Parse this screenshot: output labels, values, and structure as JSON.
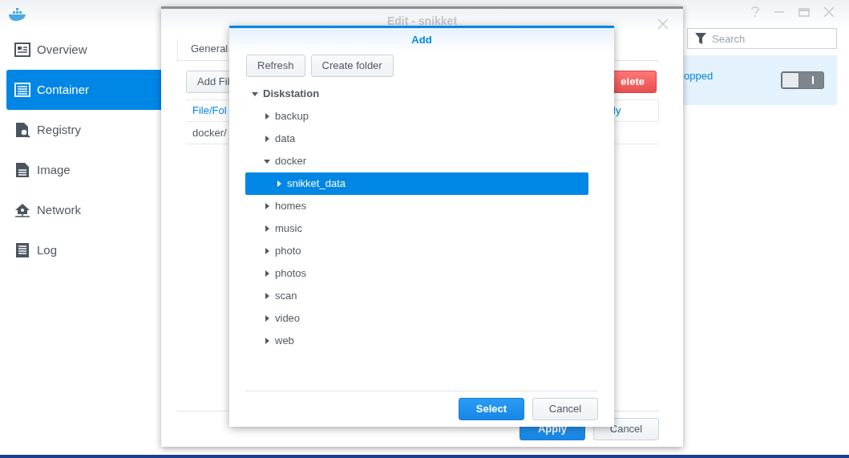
{
  "app": {
    "sidebar": [
      {
        "label": "Overview",
        "selected": false
      },
      {
        "label": "Container",
        "selected": true
      },
      {
        "label": "Registry",
        "selected": false
      },
      {
        "label": "Image",
        "selected": false
      },
      {
        "label": "Network",
        "selected": false
      },
      {
        "label": "Log",
        "selected": false
      }
    ],
    "search": {
      "placeholder": "Search"
    },
    "container_row": {
      "status": "opped",
      "on": false,
      "selected": true
    }
  },
  "edit_window": {
    "title": "Edit - snikket",
    "tab": "General",
    "buttons": [
      {
        "label": "Add Fil",
        "kind": "default"
      },
      {
        "label": "elete",
        "kind": "danger"
      }
    ],
    "columns": [
      "File/Fol",
      "ly"
    ],
    "rows": [
      [
        "docker/"
      ]
    ],
    "footer_buttons": [
      {
        "label": "Apply",
        "kind": "primary"
      },
      {
        "label": "Cancel",
        "kind": "default"
      }
    ]
  },
  "add_dialog": {
    "title": "Add",
    "toolbar": [
      "Refresh",
      "Create folder"
    ],
    "tree": [
      {
        "label": "Diskstation",
        "expanded": true,
        "selected": false,
        "children": [
          {
            "label": "backup",
            "expanded": false,
            "selected": false
          },
          {
            "label": "data",
            "expanded": false,
            "selected": false
          },
          {
            "label": "docker",
            "expanded": true,
            "selected": false,
            "children": [
              {
                "label": "snikket_data",
                "expanded": false,
                "selected": true
              }
            ]
          },
          {
            "label": "homes",
            "expanded": false,
            "selected": false
          },
          {
            "label": "music",
            "expanded": false,
            "selected": false
          },
          {
            "label": "photo",
            "expanded": false,
            "selected": false
          },
          {
            "label": "photos",
            "expanded": false,
            "selected": false
          },
          {
            "label": "scan",
            "expanded": false,
            "selected": false
          },
          {
            "label": "video",
            "expanded": false,
            "selected": false
          },
          {
            "label": "web",
            "expanded": false,
            "selected": false
          }
        ]
      }
    ],
    "buttons": [
      {
        "label": "Select",
        "kind": "primary"
      },
      {
        "label": "Cancel",
        "kind": "default"
      }
    ]
  }
}
